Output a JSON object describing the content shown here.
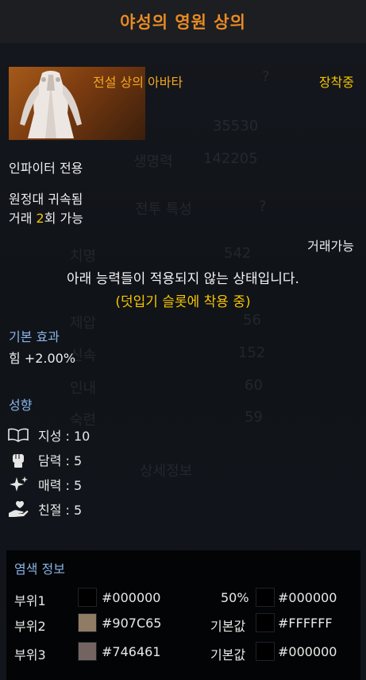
{
  "header": {
    "title": "야성의 영원 상의"
  },
  "background_text": {
    "values": [
      "35530",
      "142205",
      "542",
      "56",
      "152",
      "60",
      "59"
    ],
    "labels": [
      "생명력",
      "전투 특성",
      "치명",
      "제압",
      "신속",
      "인내",
      "숙련",
      "상세정보"
    ],
    "misc": [
      "?",
      "?"
    ]
  },
  "item": {
    "name": "전설 상의 아바타",
    "equipped": "장착중",
    "class_restriction": "인파이터 전용",
    "bound": "원정대 귀속됨",
    "trade_prefix": "거래 ",
    "trade_count": "2",
    "trade_suffix": "회 가능",
    "tradeable": "거래가능"
  },
  "notice": {
    "line1": "아래 능력들이 적용되지 않는 상태입니다.",
    "line2": "(덧입기 슬롯에 착용 중)"
  },
  "base_effect": {
    "title": "기본 효과",
    "value": "힘 +2.00%"
  },
  "tendency": {
    "title": "성향",
    "items": [
      {
        "icon": "book-icon",
        "label": "지성 : 10"
      },
      {
        "icon": "fist-icon",
        "label": "담력 : 5"
      },
      {
        "icon": "sparkle-icon",
        "label": "매력 : 5"
      },
      {
        "icon": "hand-heart-icon",
        "label": "친절 : 5"
      }
    ]
  },
  "dye": {
    "title": "염색 정보",
    "rows": [
      {
        "label": "부위1",
        "color1": "#000000",
        "hex1": "#000000",
        "value": "50%",
        "color2": "#000000",
        "hex2": "#000000"
      },
      {
        "label": "부위2",
        "color1": "#907C65",
        "hex1": "#907C65",
        "value": "기본값",
        "color2": "#000000",
        "hex2": "#FFFFFF"
      },
      {
        "label": "부위3",
        "color1": "#746461",
        "hex1": "#746461",
        "value": "기본값",
        "color2": "#000000",
        "hex2": "#000000"
      }
    ]
  },
  "colors": {
    "title": "#e88a24",
    "item_name": "#f5a623",
    "highlight": "#f5c400",
    "section": "#8ab4e8"
  }
}
